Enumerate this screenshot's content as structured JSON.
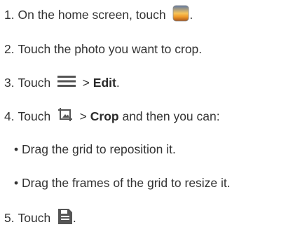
{
  "steps": [
    {
      "num": "1.",
      "text": "On the home screen, touch",
      "end": "."
    },
    {
      "num": "2.",
      "text": "Touch the photo you want to crop."
    },
    {
      "num": "3.",
      "text": "Touch",
      "sep": ">",
      "bold": "Edit",
      "end": "."
    },
    {
      "num": "4.",
      "text": "Touch",
      "sep": ">",
      "bold": "Crop",
      "after": "and then you can:"
    },
    {
      "num": "5.",
      "text": "Touch",
      "end": "."
    }
  ],
  "bullets": [
    {
      "mark": "•",
      "text": "Drag the grid to reposition it."
    },
    {
      "mark": "•",
      "text": "Drag the frames of the grid to resize it."
    }
  ],
  "icons": {
    "gallery": "gallery-app-icon",
    "menu": "menu-icon",
    "crop": "crop-image-icon",
    "save": "save-icon"
  },
  "colors": {
    "text": "#333333",
    "icon_gray": "#5a5a5a",
    "gallery_sky": "#6b7fa6",
    "gallery_sunset": "#f0a030"
  }
}
